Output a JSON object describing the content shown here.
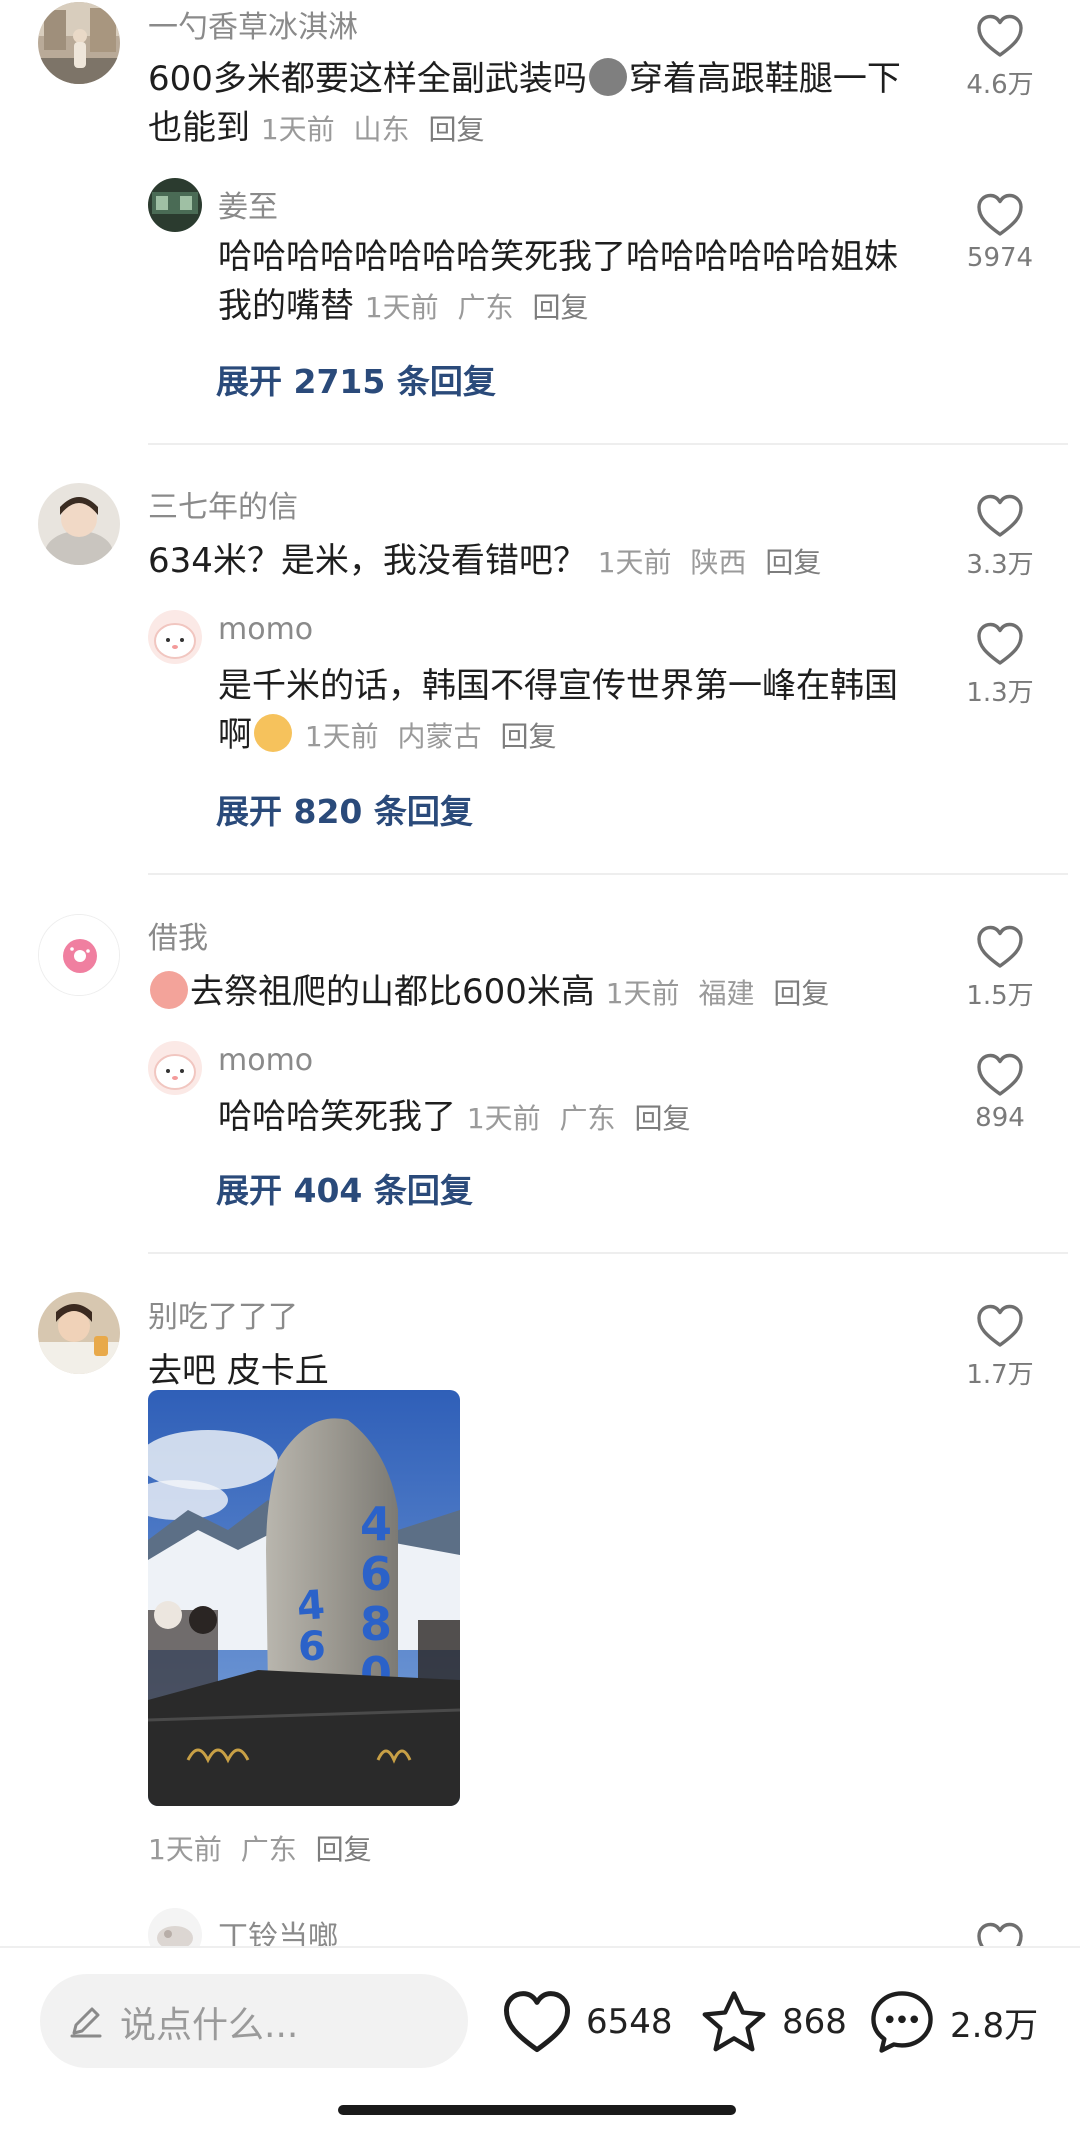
{
  "comments": [
    {
      "user": "一勺香草冰淇淋",
      "text_a": "600多米都要这样全副武装吗",
      "text_b": "穿着高跟鞋腿一下也能到",
      "time": "1天前",
      "location": "山东",
      "reply": "回复",
      "likes": "4.6万",
      "reply_item": {
        "user": "姜至",
        "text": "哈哈哈哈哈哈哈哈笑死我了哈哈哈哈哈哈姐妹我的嘴替",
        "time": "1天前",
        "location": "广东",
        "reply": "回复",
        "likes": "5974"
      },
      "expand": "展开 2715 条回复"
    },
    {
      "user": "三七年的信",
      "text": "634米？是米，我没看错吧？",
      "time": "1天前",
      "location": "陕西",
      "reply": "回复",
      "likes": "3.3万",
      "reply_item": {
        "user": "momo",
        "text": "是千米的话，韩国不得宣传世界第一峰在韩国啊",
        "time": "1天前",
        "location": "内蒙古",
        "reply": "回复",
        "likes": "1.3万"
      },
      "expand": "展开 820 条回复"
    },
    {
      "user": "借我",
      "text": "去祭祖爬的山都比600米高",
      "time": "1天前",
      "location": "福建",
      "reply": "回复",
      "likes": "1.5万",
      "reply_item": {
        "user": "momo",
        "text": "哈哈哈笑死我了",
        "time": "1天前",
        "location": "广东",
        "reply": "回复",
        "likes": "894"
      },
      "expand": "展开 404 条回复"
    },
    {
      "user": "别吃了了了",
      "text": "去吧 皮卡丘",
      "time": "1天前",
      "location": "广东",
      "reply": "回复",
      "likes": "1.7万",
      "photo_text": "4680",
      "reply_item": {
        "user": "丁铃当啷"
      }
    }
  ],
  "bottom": {
    "placeholder": "说点什么...",
    "likes": "6548",
    "favorites": "868",
    "comments": "2.8万"
  },
  "colors": {
    "expand_link": "#2a4a7a",
    "username": "#8a8a8a",
    "meta": "#9a9a9a"
  }
}
